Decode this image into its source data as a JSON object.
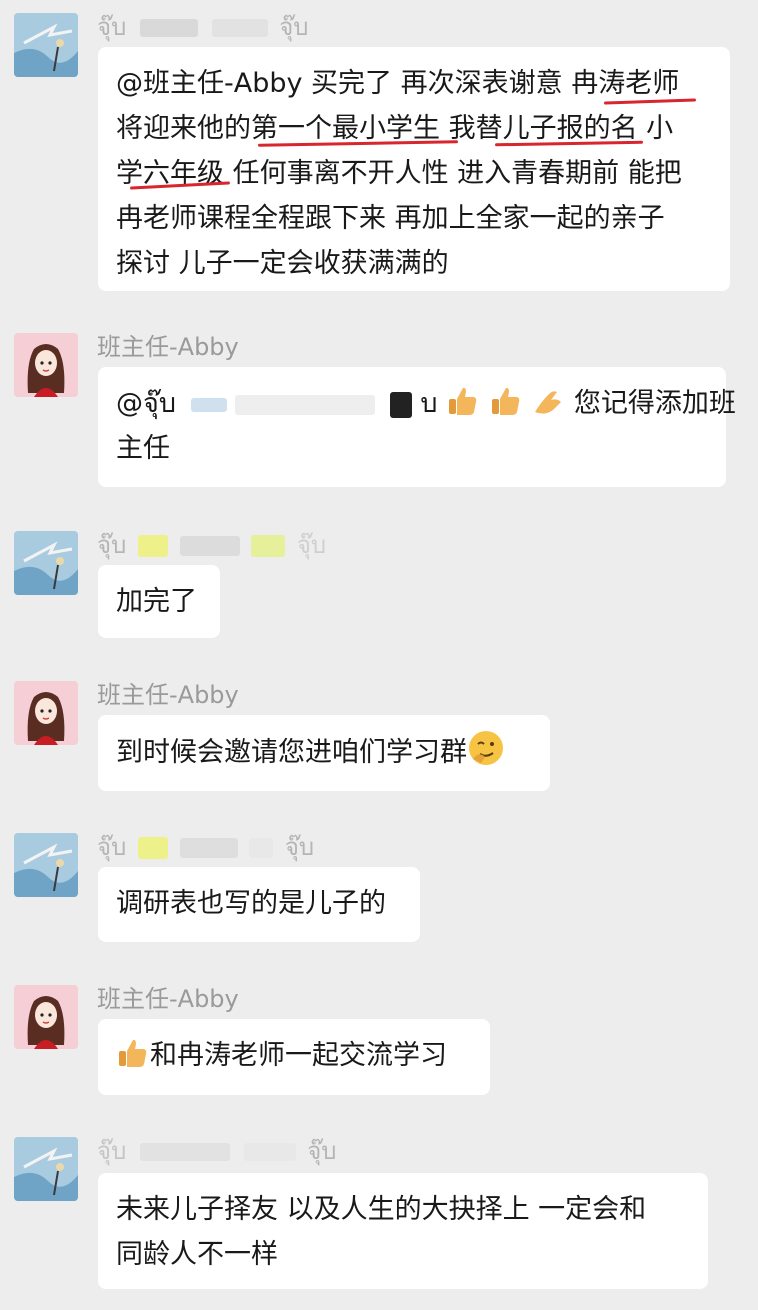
{
  "messages": [
    {
      "sender": "จุ๊บ",
      "sender_suffix": "จุ๊บ",
      "avatar": "sky-scenery-avatar",
      "lines": [
        "@班主任-Abby 买完了  再次深表谢意  冉涛老师",
        "将迎来他的第一个最小学生  我替儿子报的名 小",
        "学六年级 任何事离不开人性 进入青春期前 能把",
        "冉老师课程全程跟下来 再加上全家一起的亲子",
        "探讨 儿子一定会收获满满的"
      ]
    },
    {
      "sender": "班主任-Abby",
      "avatar": "girl-cartoon-avatar",
      "prefix": "@จุ๊บ",
      "mention_suffix": "บ",
      "emojis": [
        "thumbs-up-icon",
        "thumbs-up-icon",
        "pinching-hand-icon"
      ],
      "line1_tail": "您记得添加班",
      "line2": "主任"
    },
    {
      "sender": "จุ๊บ",
      "sender_suffix": "จุ๊บ",
      "avatar": "sky-scenery-avatar",
      "text": "加完了"
    },
    {
      "sender": "班主任-Abby",
      "avatar": "girl-cartoon-avatar",
      "text": "到时候会邀请您进咱们学习群",
      "emoji": "thinking-smile-icon"
    },
    {
      "sender": "จุ๊บ",
      "sender_suffix": "จุ๊บ",
      "avatar": "sky-scenery-avatar",
      "text": "调研表也写的是儿子的"
    },
    {
      "sender": "班主任-Abby",
      "avatar": "girl-cartoon-avatar",
      "emoji": "thumbs-up-icon",
      "text": "和冉涛老师一起交流学习"
    },
    {
      "sender": "จุ๊บ",
      "sender_suffix": "จุ๊บ",
      "avatar": "sky-scenery-avatar",
      "lines": [
        "未来儿子择友  以及人生的大抉择上  一定会和",
        "同龄人不一样"
      ]
    }
  ],
  "colors": {
    "background": "#ededed",
    "bubble": "#ffffff",
    "sender_name": "#9a9a9a",
    "annotation_red": "#d8252e"
  }
}
